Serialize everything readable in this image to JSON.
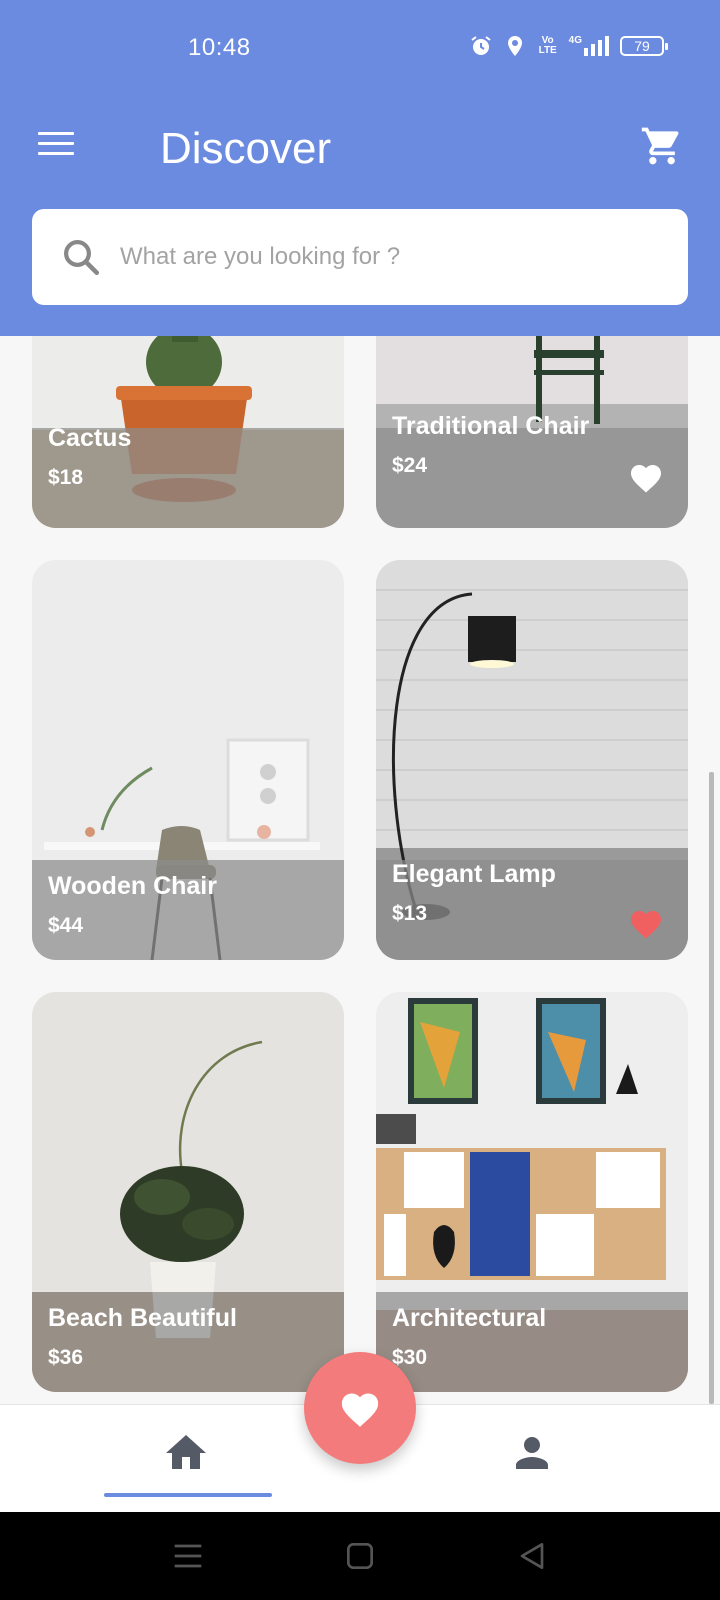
{
  "status_bar": {
    "time": "10:48",
    "volte_label": "Vo LTE",
    "network_label": "4G",
    "battery": "79"
  },
  "header": {
    "title": "Discover",
    "menu_icon": "hamburger-menu-icon",
    "cart_icon": "shopping-cart-icon",
    "background": "#6b8be0"
  },
  "search": {
    "placeholder": "What are you looking for ?",
    "value": ""
  },
  "products": [
    {
      "name": "Cactus",
      "price": "$18",
      "favorite": false
    },
    {
      "name": "Traditional Chair",
      "price": "$24",
      "favorite": true,
      "favorite_color": "#ffffff"
    },
    {
      "name": "Wooden Chair",
      "price": "$44",
      "favorite": false
    },
    {
      "name": "Elegant Lamp",
      "price": "$13",
      "favorite": true,
      "favorite_color": "#f06060"
    },
    {
      "name": "Beach Beautiful",
      "price": "$36",
      "favorite": false
    },
    {
      "name": "Architectural",
      "price": "$30",
      "favorite": false
    }
  ],
  "bottom_nav": {
    "items": [
      "home-icon",
      "profile-icon"
    ],
    "active": "home-icon",
    "fab_icon": "heart-icon",
    "fab_color": "#f37b7b"
  },
  "system_nav": [
    "recents-icon",
    "home-square-icon",
    "back-triangle-icon"
  ]
}
